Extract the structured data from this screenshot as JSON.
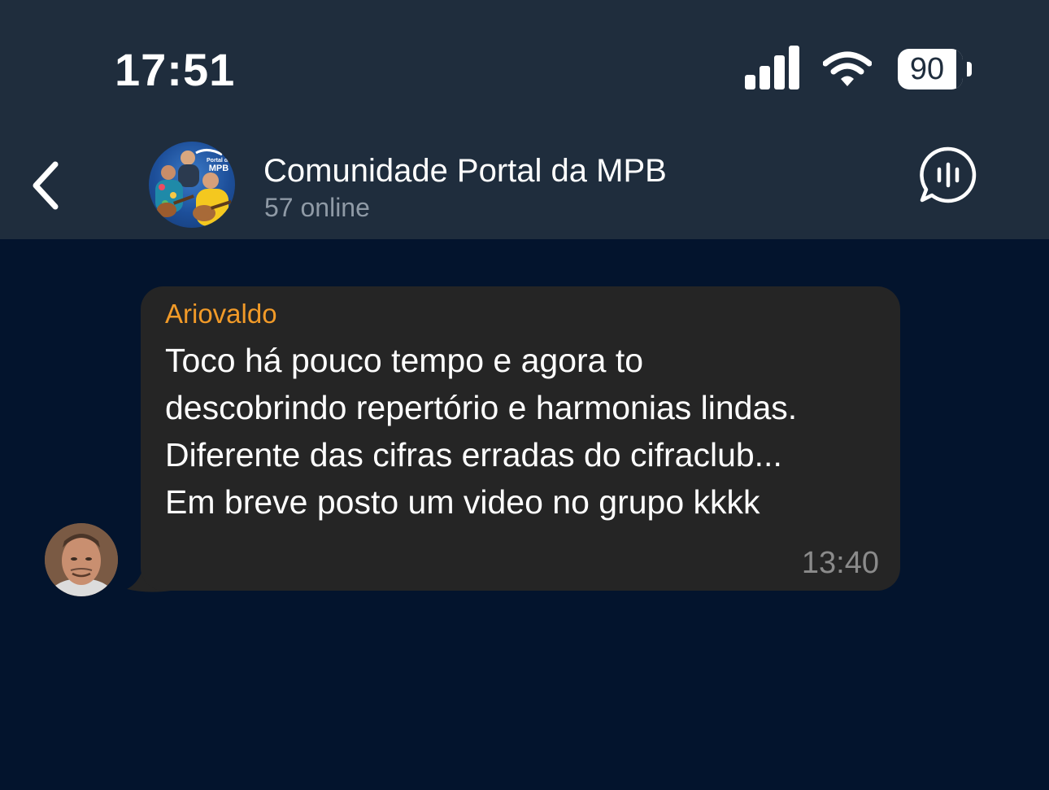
{
  "status_bar": {
    "time": "17:51",
    "battery_level": "90",
    "battery_fraction": 0.9,
    "icons": [
      "signal-icon",
      "wifi-icon",
      "battery-icon"
    ]
  },
  "header": {
    "title": "Comunidade Portal da MPB",
    "subtitle": "57 online",
    "back_icon": "chevron-left-icon",
    "avatar_logo_lines": [
      "Portal da",
      "MPB"
    ],
    "action_icon": "voice-chat-icon"
  },
  "message": {
    "sender": "Ariovaldo",
    "lines": [
      "Toco há pouco tempo e agora to",
      "descobrindo repertório e harmonias lindas.",
      "Diferente das cifras erradas do cifraclub...",
      "Em breve posto um video no grupo kkkk"
    ],
    "time": "13:40"
  },
  "colors": {
    "background": "#03142d",
    "header_background": "#1f2d3d",
    "bubble_background": "#252525",
    "sender_name": "#f19a28",
    "subtitle": "#8f9aa6",
    "timestamp": "#8b8b8b"
  }
}
